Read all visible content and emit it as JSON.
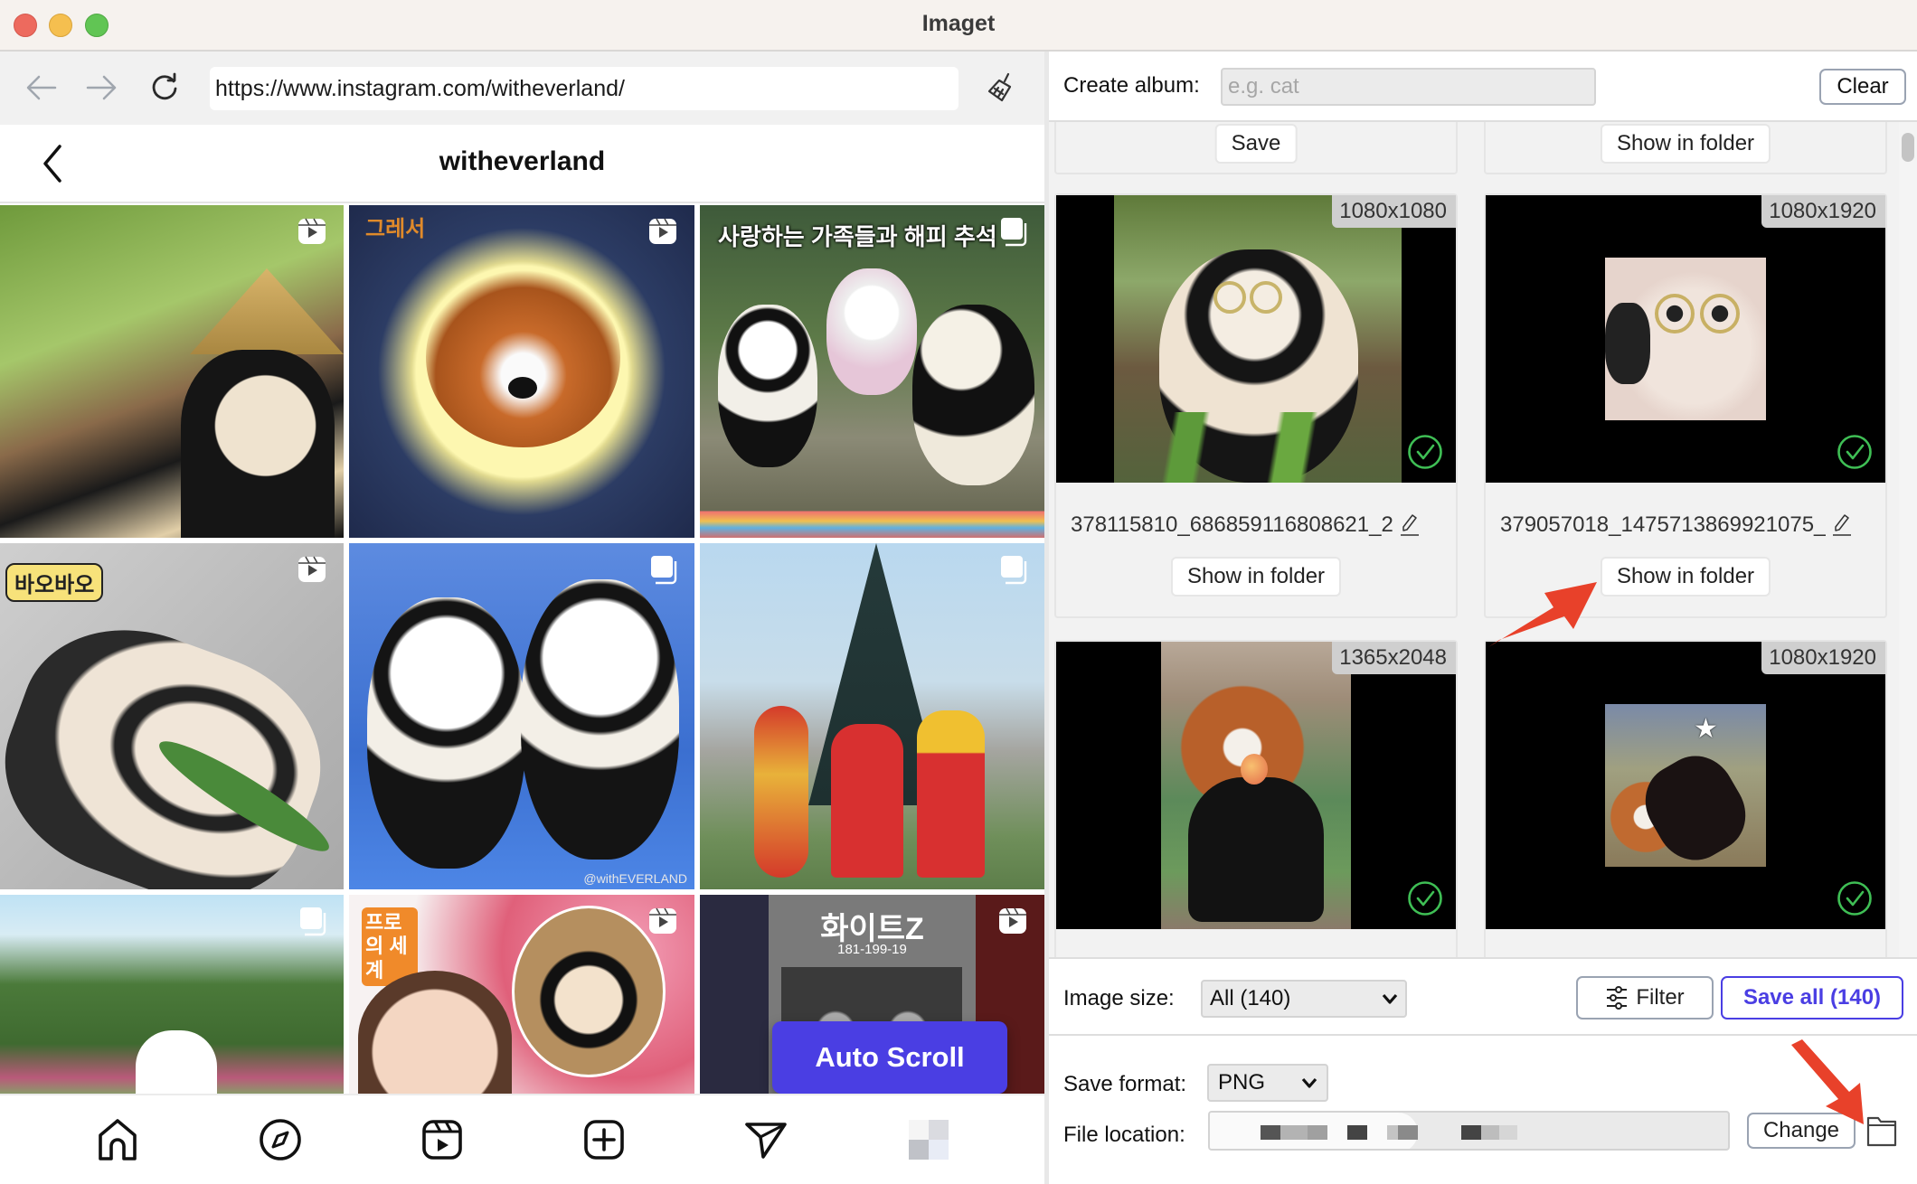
{
  "window": {
    "title": "Imaget"
  },
  "browser": {
    "url": "https://www.instagram.com/witheverland/",
    "back_icon": "arrow-left-icon",
    "forward_icon": "arrow-right-icon",
    "reload_icon": "reload-icon",
    "clear_cache_icon": "broom-icon"
  },
  "instagram": {
    "username": "witheverland",
    "tiles": [
      {
        "type": "reel",
        "caption": ""
      },
      {
        "type": "reel",
        "caption": "그레서"
      },
      {
        "type": "carousel",
        "caption": "사랑하는 가족들과 해피 추석"
      },
      {
        "type": "reel",
        "caption": "바오바오"
      },
      {
        "type": "carousel",
        "caption": "@withEVERLAND"
      },
      {
        "type": "carousel",
        "caption": ""
      },
      {
        "type": "carousel",
        "caption": ""
      },
      {
        "type": "reel",
        "caption": "프로의 세계"
      },
      {
        "type": "reel",
        "caption": "화이트Z",
        "subcaption": "181-199-19"
      }
    ],
    "auto_scroll_label": "Auto Scroll",
    "bottom_nav": [
      "home-icon",
      "explore-icon",
      "reels-icon",
      "create-icon",
      "direct-icon",
      "profile-avatar"
    ]
  },
  "album": {
    "label": "Create album:",
    "placeholder": "e.g. cat",
    "value": "",
    "clear_label": "Clear"
  },
  "cards": {
    "partial_top": [
      {
        "button": "Save"
      },
      {
        "button": "Show in folder"
      }
    ],
    "items": [
      {
        "dimensions": "1080x1080",
        "filename": "378115810_686859116808621_2",
        "button": "Show in folder",
        "saved": true
      },
      {
        "dimensions": "1080x1920",
        "filename": "379057018_1475713869921075_",
        "button": "Show in folder",
        "saved": true
      },
      {
        "dimensions": "1365x2048",
        "filename": "",
        "button": "",
        "saved": true
      },
      {
        "dimensions": "1080x1920",
        "filename": "",
        "button": "",
        "saved": true
      }
    ]
  },
  "filters": {
    "image_size_label": "Image size:",
    "image_size_value": "All (140)",
    "filter_label": "Filter",
    "save_all_label": "Save all (140)"
  },
  "save": {
    "format_label": "Save format:",
    "format_value": "PNG",
    "location_label": "File location:",
    "location_value": "",
    "change_label": "Change",
    "open_folder_icon": "folder-icon"
  },
  "colors": {
    "accent": "#4a3ee3",
    "annotation_arrow": "#e8412a",
    "saved_check": "#3fbf55"
  }
}
